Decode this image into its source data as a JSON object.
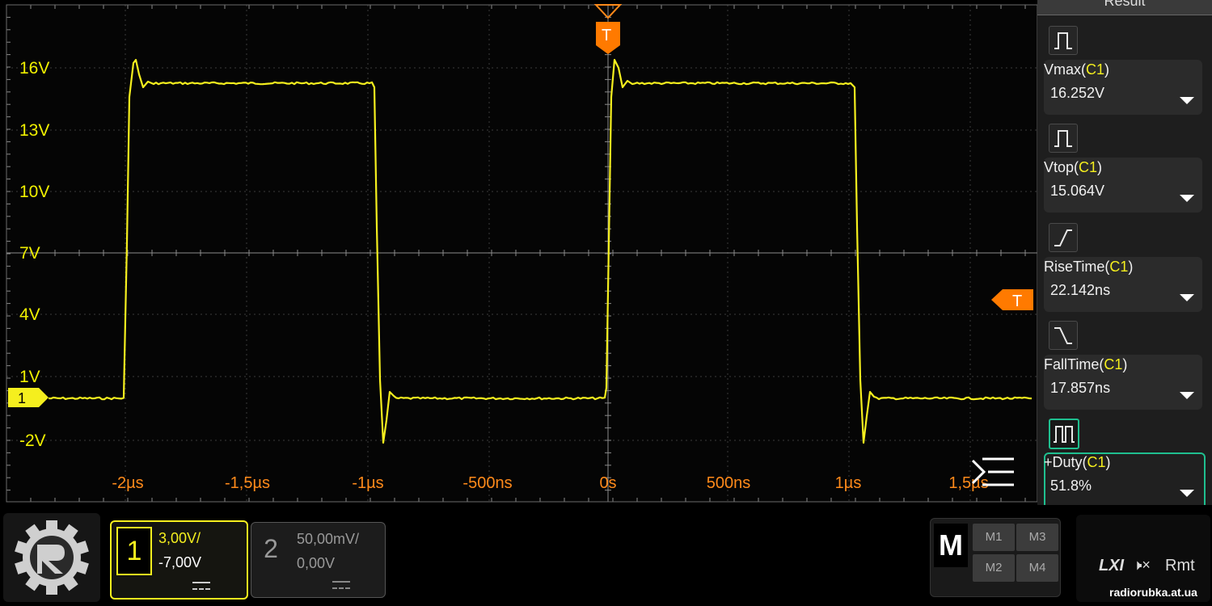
{
  "scope": {
    "y_labels": [
      "16V",
      "13V",
      "10V",
      "7V",
      "4V",
      "1V",
      "-2V"
    ],
    "x_labels": [
      "-2µs",
      "-1,5µs",
      "-1µs",
      "-500ns",
      "0s",
      "500ns",
      "1µs",
      "1,5µs"
    ],
    "channel_marker": "1",
    "trigger_marker_top": "T",
    "trigger_marker_right": "T",
    "colors": {
      "trace": "#f5ef1e",
      "time_labels": "#ff8a1a",
      "trigger": "#ff8a1a",
      "active_border": "#1fbf8f"
    }
  },
  "panel": {
    "header": "Result",
    "measurements": [
      {
        "name": "Vmax",
        "channel": "C1",
        "value": "16.252V",
        "icon": "pulse-icon"
      },
      {
        "name": "Vtop",
        "channel": "C1",
        "value": "15.064V",
        "icon": "pulse-icon"
      },
      {
        "name": "RiseTime",
        "channel": "C1",
        "value": "22.142ns",
        "icon": "rise-edge-icon"
      },
      {
        "name": "FallTime",
        "channel": "C1",
        "value": "17.857ns",
        "icon": "fall-edge-icon"
      },
      {
        "name": "+Duty",
        "channel": "C1",
        "value": "51.8%",
        "icon": "duty-icon"
      }
    ]
  },
  "bottom": {
    "ch1": {
      "number": "1",
      "scale": "3,00V/",
      "offset": "-7,00V"
    },
    "ch2": {
      "number": "2",
      "scale": "50,00mV/",
      "offset": "0,00V"
    },
    "math": {
      "label": "M",
      "buttons": [
        "M1",
        "M3",
        "M2",
        "M4"
      ]
    },
    "status": {
      "lxi": "LXI",
      "speaker": "🕨×",
      "remote": "Rmt"
    }
  },
  "watermark": "radiorubka.at.ua"
}
